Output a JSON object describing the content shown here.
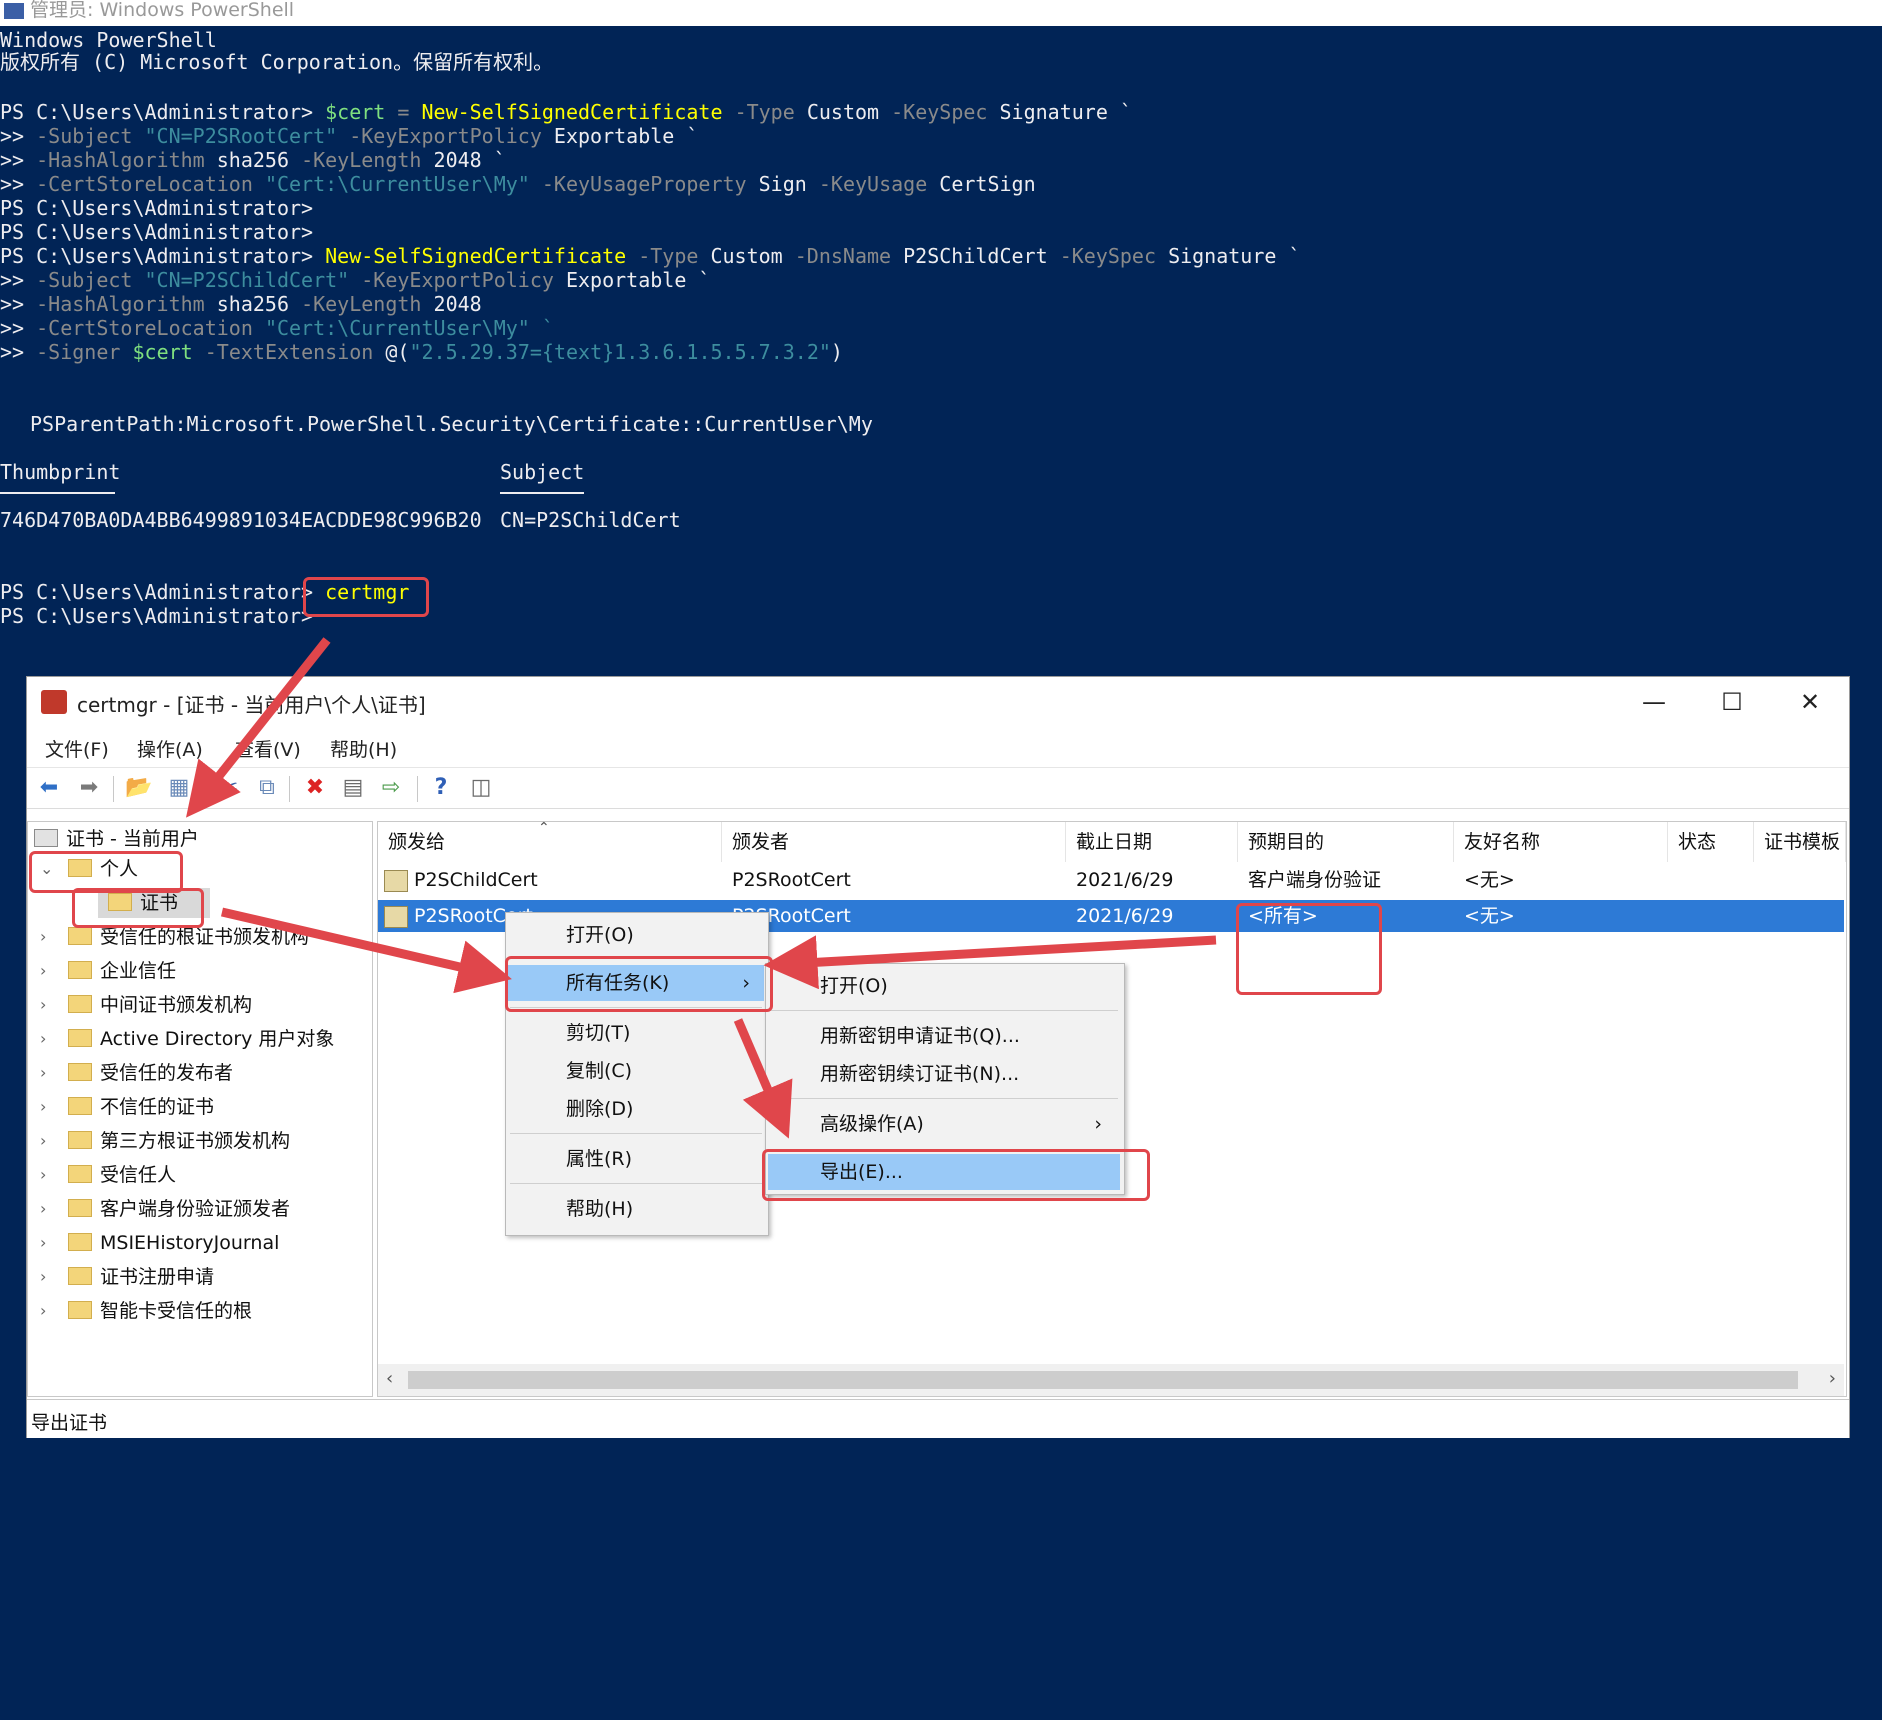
{
  "ps": {
    "window_title": "管理员: Windows PowerShell",
    "header1": "Windows PowerShell",
    "header2": "版权所有 (C) Microsoft Corporation。保留所有权利。",
    "prompt": "PS C:\\Users\\Administrator>",
    "cont": ">>",
    "cmd1": {
      "var": "$cert",
      "eq": "=",
      "cmdlet": "New-SelfSignedCertificate",
      "p_type": "-Type",
      "v_type": "Custom",
      "p_keyspec": "-KeySpec",
      "v_keyspec": "Signature `",
      "p_subject": "-Subject",
      "v_subject": "\"CN=P2SRootCert\"",
      "p_export": "-KeyExportPolicy",
      "v_export": "Exportable `",
      "p_hash": "-HashAlgorithm",
      "v_hash": "sha256",
      "p_len": "-KeyLength",
      "v_len": "2048 `",
      "p_store": "-CertStoreLocation",
      "v_store": "\"Cert:\\CurrentUser\\My\"",
      "p_kup": "-KeyUsageProperty",
      "v_kup": "Sign",
      "p_ku": "-KeyUsage",
      "v_ku": "CertSign"
    },
    "cmd2": {
      "cmdlet": "New-SelfSignedCertificate",
      "p_type": "-Type",
      "v_type": "Custom",
      "p_dns": "-DnsName",
      "v_dns": "P2SChildCert",
      "p_keyspec": "-KeySpec",
      "v_keyspec": "Signature `",
      "p_subject": "-Subject",
      "v_subject": "\"CN=P2SChildCert\"",
      "p_export": "-KeyExportPolicy",
      "v_export": "Exportable `",
      "p_hash": "-HashAlgorithm",
      "v_hash": "sha256",
      "p_len": "-KeyLength",
      "v_len": "2048",
      "p_store": "-CertStoreLocation",
      "v_store": "\"Cert:\\CurrentUser\\My\" `",
      "p_signer": "-Signer",
      "v_signer": "$cert",
      "p_ext": "-TextExtension",
      "v_ext_open": "@(",
      "v_ext_str": "\"2.5.29.37={text}1.3.6.1.5.5.7.3.2\"",
      "v_ext_close": ")"
    },
    "psparentpath": "PSParentPath:Microsoft.PowerShell.Security\\Certificate::CurrentUser\\My",
    "col_thumbprint": "Thumbprint",
    "col_subject": "Subject",
    "thumbprint": "746D470BA0DA4BB6499891034EACDDE98C996B20",
    "subject": "CN=P2SChildCert",
    "cmd3": "certmgr"
  },
  "certmgr": {
    "title": "certmgr - [证书 - 当前用户\\个人\\证书]",
    "menu": [
      "文件(F)",
      "操作(A)",
      "查看(V)",
      "帮助(H)"
    ],
    "tree_root": "证书 - 当前用户",
    "tree": [
      "个人",
      "证书",
      "受信任的根证书颁发机构",
      "企业信任",
      "中间证书颁发机构",
      "Active Directory 用户对象",
      "受信任的发布者",
      "不信任的证书",
      "第三方根证书颁发机构",
      "受信任人",
      "客户端身份验证颁发者",
      "MSIEHistoryJournal",
      "证书注册申请",
      "智能卡受信任的根"
    ],
    "columns": [
      "颁发给",
      "颁发者",
      "截止日期",
      "预期目的",
      "友好名称",
      "状态",
      "证书模板"
    ],
    "rows": [
      [
        "P2SChildCert",
        "P2SRootCert",
        "2021/6/29",
        "客户端身份验证",
        "<无>"
      ],
      [
        "P2SRootCert",
        "P2SRootCert",
        "2021/6/29",
        "<所有>",
        "<无>"
      ]
    ],
    "status": "导出证书"
  },
  "context_menu": {
    "items": [
      "打开(O)",
      "所有任务(K)",
      "剪切(T)",
      "复制(C)",
      "删除(D)",
      "属性(R)",
      "帮助(H)"
    ]
  },
  "submenu": {
    "items": [
      "打开(O)",
      "用新密钥申请证书(Q)...",
      "用新密钥续订证书(N)...",
      "高级操作(A)",
      "导出(E)..."
    ]
  },
  "colors": {
    "console_bg": "#012456",
    "annotation": "#e0464b",
    "selection": "#2d7ad6",
    "menu_hover": "#99c9f7"
  }
}
